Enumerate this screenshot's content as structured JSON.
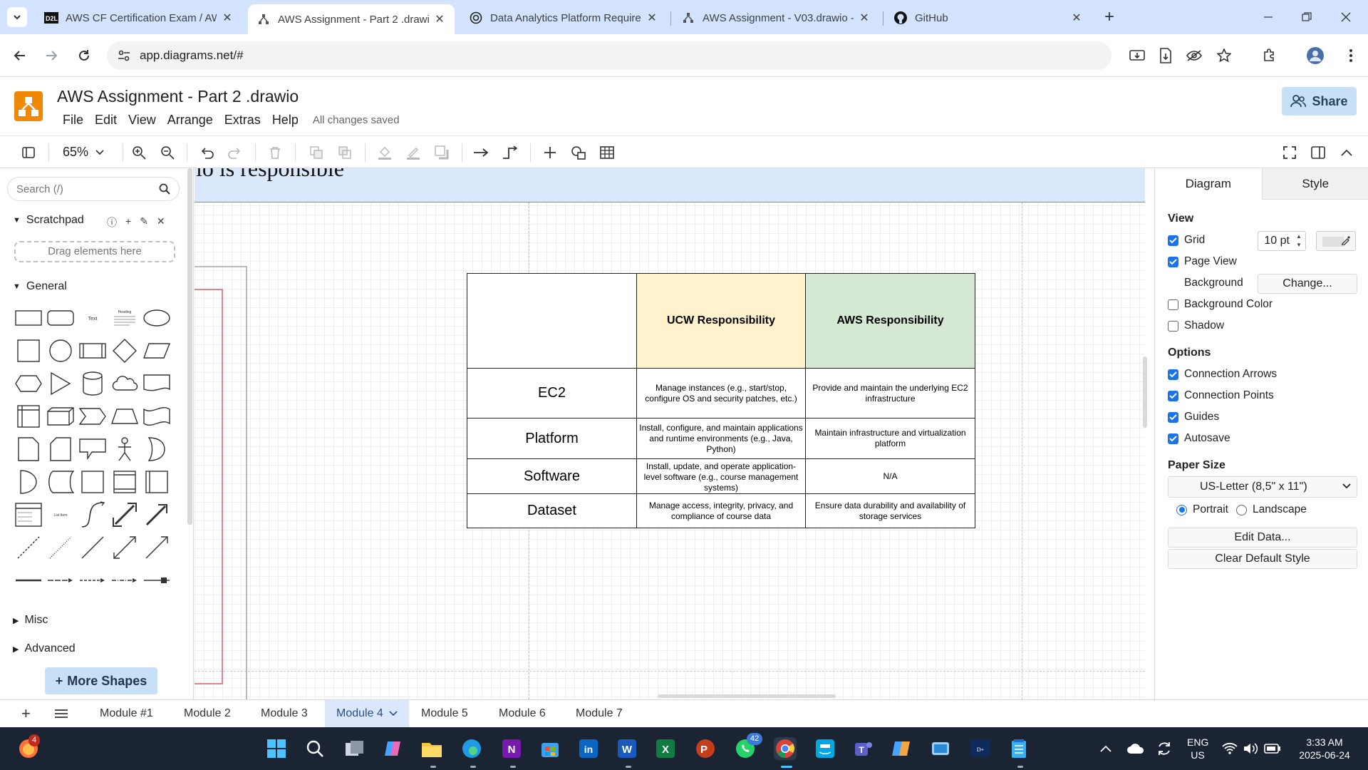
{
  "browser": {
    "tabs": [
      {
        "title": "AWS CF Certification Exam / AW",
        "icon": "d2l-icon",
        "active": false
      },
      {
        "title": "AWS Assignment - Part 2 .drawi",
        "icon": "drawio-icon",
        "active": true
      },
      {
        "title": "Data Analytics Platform Require",
        "icon": "chatgpt-icon",
        "active": false
      },
      {
        "title": "AWS Assignment - V03.drawio -",
        "icon": "drawio-icon",
        "active": false
      },
      {
        "title": "GitHub",
        "icon": "github-icon",
        "active": false
      }
    ],
    "url": "app.diagrams.net/#"
  },
  "app": {
    "title": "AWS Assignment - Part 2 .drawio",
    "menu": [
      "File",
      "Edit",
      "View",
      "Arrange",
      "Extras",
      "Help"
    ],
    "save_status": "All changes saved",
    "share_label": "Share",
    "zoom": "65%"
  },
  "sidebar": {
    "search_placeholder": "Search (/)",
    "scratchpad_label": "Scratchpad",
    "drag_hint": "Drag elements here",
    "general_label": "General",
    "misc_label": "Misc",
    "advanced_label": "Advanced",
    "more_shapes_label": "More Shapes",
    "shape_text_label": "Text",
    "shape_heading_label": "Heading",
    "shape_list_item_label": "List Item"
  },
  "canvas": {
    "banner_text": "io is responsible",
    "table": {
      "headers": [
        "",
        "UCW Responsibility",
        "AWS Responsibility"
      ],
      "header_colors": [
        "#ffffff",
        "#fff2cc",
        "#d5e8d4"
      ],
      "rows": [
        {
          "label": "EC2",
          "ucw": "Manage instances (e.g., start/stop, configure OS and security patches, etc.)",
          "aws": "Provide and maintain the underlying EC2 infrastructure"
        },
        {
          "label": "Platform",
          "ucw": "Install, configure, and maintain applications and runtime environments (e.g., Java, Python)",
          "aws": "Maintain infrastructure and virtualization platform"
        },
        {
          "label": "Software",
          "ucw": "Install, update, and operate application-level software (e.g., course management systems)",
          "aws": "N/A"
        },
        {
          "label": "Dataset",
          "ucw": "Manage access, integrity, privacy, and compliance of course data",
          "aws": "Ensure data durability and availability of storage services"
        }
      ]
    }
  },
  "format_panel": {
    "tabs": [
      "Diagram",
      "Style"
    ],
    "view_label": "View",
    "grid_label": "Grid",
    "grid_checked": true,
    "grid_size": "10 pt",
    "page_view_label": "Page View",
    "page_view_checked": true,
    "background_label": "Background",
    "change_label": "Change...",
    "background_color_label": "Background Color",
    "background_color_checked": false,
    "shadow_label": "Shadow",
    "shadow_checked": false,
    "options_label": "Options",
    "connection_arrows_label": "Connection Arrows",
    "connection_points_label": "Connection Points",
    "guides_label": "Guides",
    "autosave_label": "Autosave",
    "paper_size_label": "Paper Size",
    "paper_size_value": "US-Letter (8,5\" x 11\")",
    "portrait_label": "Portrait",
    "landscape_label": "Landscape",
    "orientation": "Portrait",
    "edit_data_label": "Edit Data...",
    "clear_style_label": "Clear Default Style"
  },
  "pages": {
    "tabs": [
      "Module #1",
      "Module 2",
      "Module 3",
      "Module 4",
      "Module 5",
      "Module 6",
      "Module 7"
    ],
    "active": "Module 4"
  },
  "taskbar": {
    "firefox_badge": "4",
    "whatsapp_badge": "42",
    "lang_top": "ENG",
    "lang_bottom": "US",
    "time": "3:33 AM",
    "date": "2025-06-24",
    "accent": "#1b2433"
  }
}
